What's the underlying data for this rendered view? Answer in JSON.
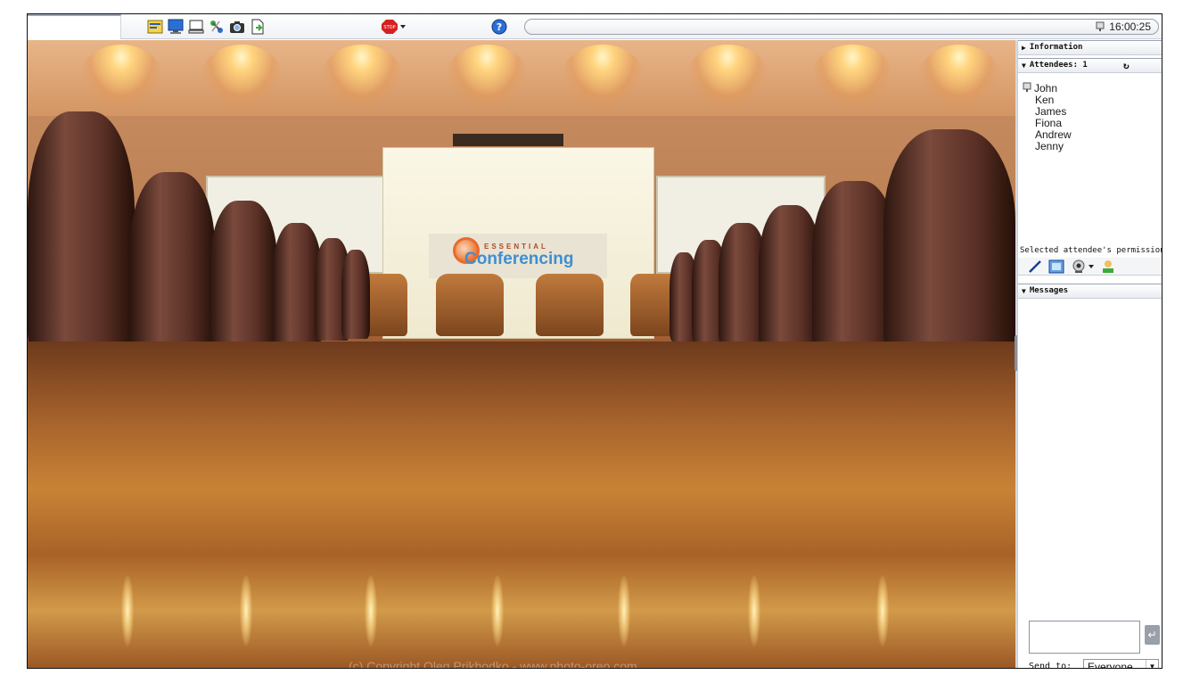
{
  "toolbar": {
    "tools": [
      {
        "name": "whiteboard-icon"
      },
      {
        "name": "desktop-share-icon"
      },
      {
        "name": "presentation-icon"
      },
      {
        "name": "network-icon"
      },
      {
        "name": "camera-icon"
      },
      {
        "name": "document-export-icon"
      }
    ],
    "stop_icon": "stop-icon",
    "help_icon": "help-icon",
    "clock": "16:00:25"
  },
  "stage": {
    "logo_top": "ESSENTIAL",
    "logo_main": "Conferencing",
    "copyright": "(c) Copyright Oleg Prikhodko - www.photo-oreo.com"
  },
  "panel": {
    "information_label": "Information",
    "attendees_label": "Attendees: 1",
    "attendees": [
      "John",
      "Ken",
      "James",
      "Fiona",
      "Andrew",
      "Jenny"
    ],
    "permissions_label": "Selected attendee's permissions:",
    "messages_label": "Messages",
    "message_input_value": "",
    "send_to_label": "Send to:",
    "send_to_value": "Everyone"
  },
  "colors": {
    "accent": "#3f8fd0",
    "stop": "#d62020"
  }
}
